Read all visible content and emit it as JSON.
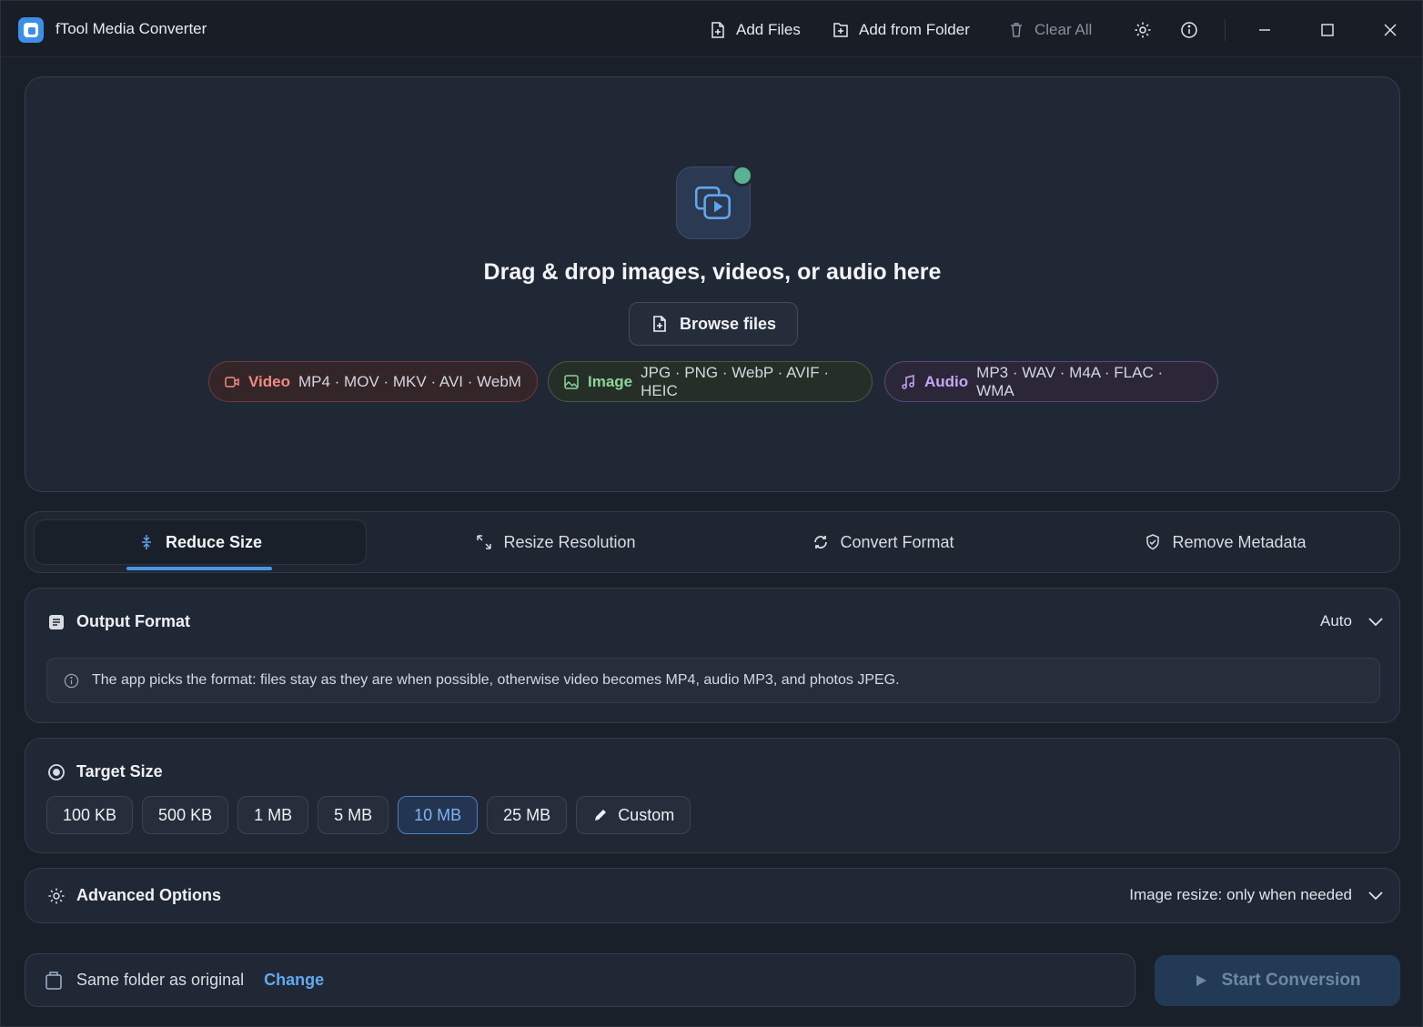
{
  "app": {
    "title": "fTool Media Converter"
  },
  "toolbar": {
    "add_files": "Add Files",
    "add_from_folder": "Add from Folder",
    "clear_all": "Clear All"
  },
  "dropzone": {
    "title": "Drag & drop images, videos, or audio here",
    "browse_label": "Browse files",
    "chips": [
      {
        "category": "Video",
        "formats": "MP4 · MOV · MKV · AVI · WebM",
        "color": "#f28b82"
      },
      {
        "category": "Image",
        "formats": "JPG · PNG · WebP · AVIF · HEIC",
        "color": "#8ed39a"
      },
      {
        "category": "Audio",
        "formats": "MP3 · WAV · M4A · FLAC · WMA",
        "color": "#c6a6f2"
      }
    ]
  },
  "tabs": [
    {
      "label": "Reduce Size",
      "active": true
    },
    {
      "label": "Resize Resolution",
      "active": false
    },
    {
      "label": "Convert Format",
      "active": false
    },
    {
      "label": "Remove Metadata",
      "active": false
    }
  ],
  "output_format": {
    "title": "Output Format",
    "value": "Auto",
    "info": "The app picks the format: files stay as they are when possible, otherwise video becomes MP4, audio MP3, and photos JPEG."
  },
  "target_size": {
    "title": "Target Size",
    "options": [
      "100 KB",
      "500 KB",
      "1 MB",
      "5 MB",
      "10 MB",
      "25 MB"
    ],
    "selected": "10 MB",
    "custom_label": "Custom"
  },
  "advanced": {
    "title": "Advanced Options",
    "summary": "Image resize: only when needed"
  },
  "output": {
    "folder_label": "Same folder as original",
    "change_label": "Change",
    "start_label": "Start Conversion"
  },
  "colors": {
    "accent": "#4b95e8",
    "link": "#62a8f0",
    "status_dot": "#59b391"
  }
}
